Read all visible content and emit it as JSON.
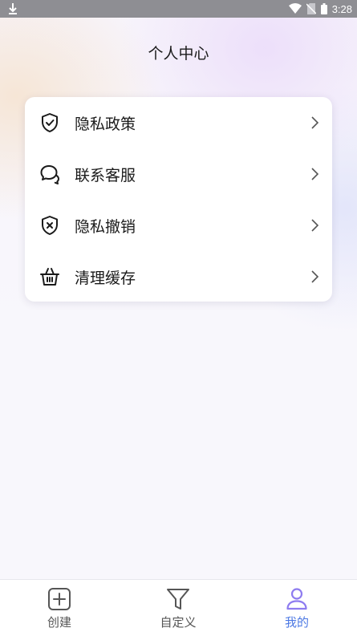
{
  "status_bar": {
    "time": "3:28",
    "icons": [
      "download-icon",
      "wifi-icon",
      "no-sim-icon",
      "battery-icon"
    ]
  },
  "page": {
    "title": "个人中心"
  },
  "menu": {
    "items": [
      {
        "label": "隐私政策",
        "icon": "shield-check-icon"
      },
      {
        "label": "联系客服",
        "icon": "chat-bubbles-icon"
      },
      {
        "label": "隐私撤销",
        "icon": "shield-x-icon"
      },
      {
        "label": "清理缓存",
        "icon": "basket-icon"
      }
    ]
  },
  "tabbar": {
    "tabs": [
      {
        "label": "创建",
        "icon": "plus-square-icon",
        "active": false
      },
      {
        "label": "自定义",
        "icon": "filter-icon",
        "active": false
      },
      {
        "label": "我的",
        "icon": "user-icon",
        "active": true
      }
    ],
    "active_color": "#4c78e3",
    "active_icon_color": "#8e7cf0"
  }
}
